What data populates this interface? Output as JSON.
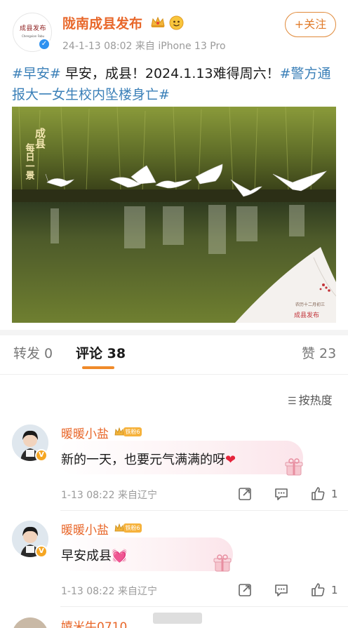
{
  "post": {
    "author": "陇南成县发布",
    "avatar_text": "成县发布",
    "avatar_sub": "Chengxian Fabu",
    "meta": "24-1-13 08:02  来自 iPhone 13 Pro",
    "follow_label": "+关注",
    "text_segments": [
      {
        "text": "#早安#",
        "tag": true
      },
      {
        "text": " 早安，成县！2024.1.13难得周六！",
        "tag": false
      },
      {
        "text": "#警方通报大一女生校内坠楼身亡#",
        "tag": true
      }
    ],
    "photo": {
      "caption_top": "成县",
      "caption_bottom": "每日一景",
      "stamp_small": "农历十二月初三",
      "stamp_brand": "成县发布"
    }
  },
  "tabs": {
    "forward": "转发 0",
    "comment": "评论 38",
    "like": "赞 23"
  },
  "sort_label": "按热度",
  "comments": [
    {
      "name": "暖暖小盐",
      "fan_badge": "铁粉6",
      "text": "新的一天，也要元气满满的呀",
      "emoji": "❤",
      "time": "1-13 08:22  来自辽宁",
      "likes": "1"
    },
    {
      "name": "暖暖小盐",
      "fan_badge": "铁粉6",
      "text": "早安成县",
      "emoji": "💓",
      "time": "1-13 08:22  来自辽宁",
      "likes": "1"
    },
    {
      "name": "嬉米牛0710"
    }
  ],
  "colors": {
    "accent": "#e8672a",
    "tag": "#3b80b8",
    "tab_underline": "#f08a2a"
  }
}
